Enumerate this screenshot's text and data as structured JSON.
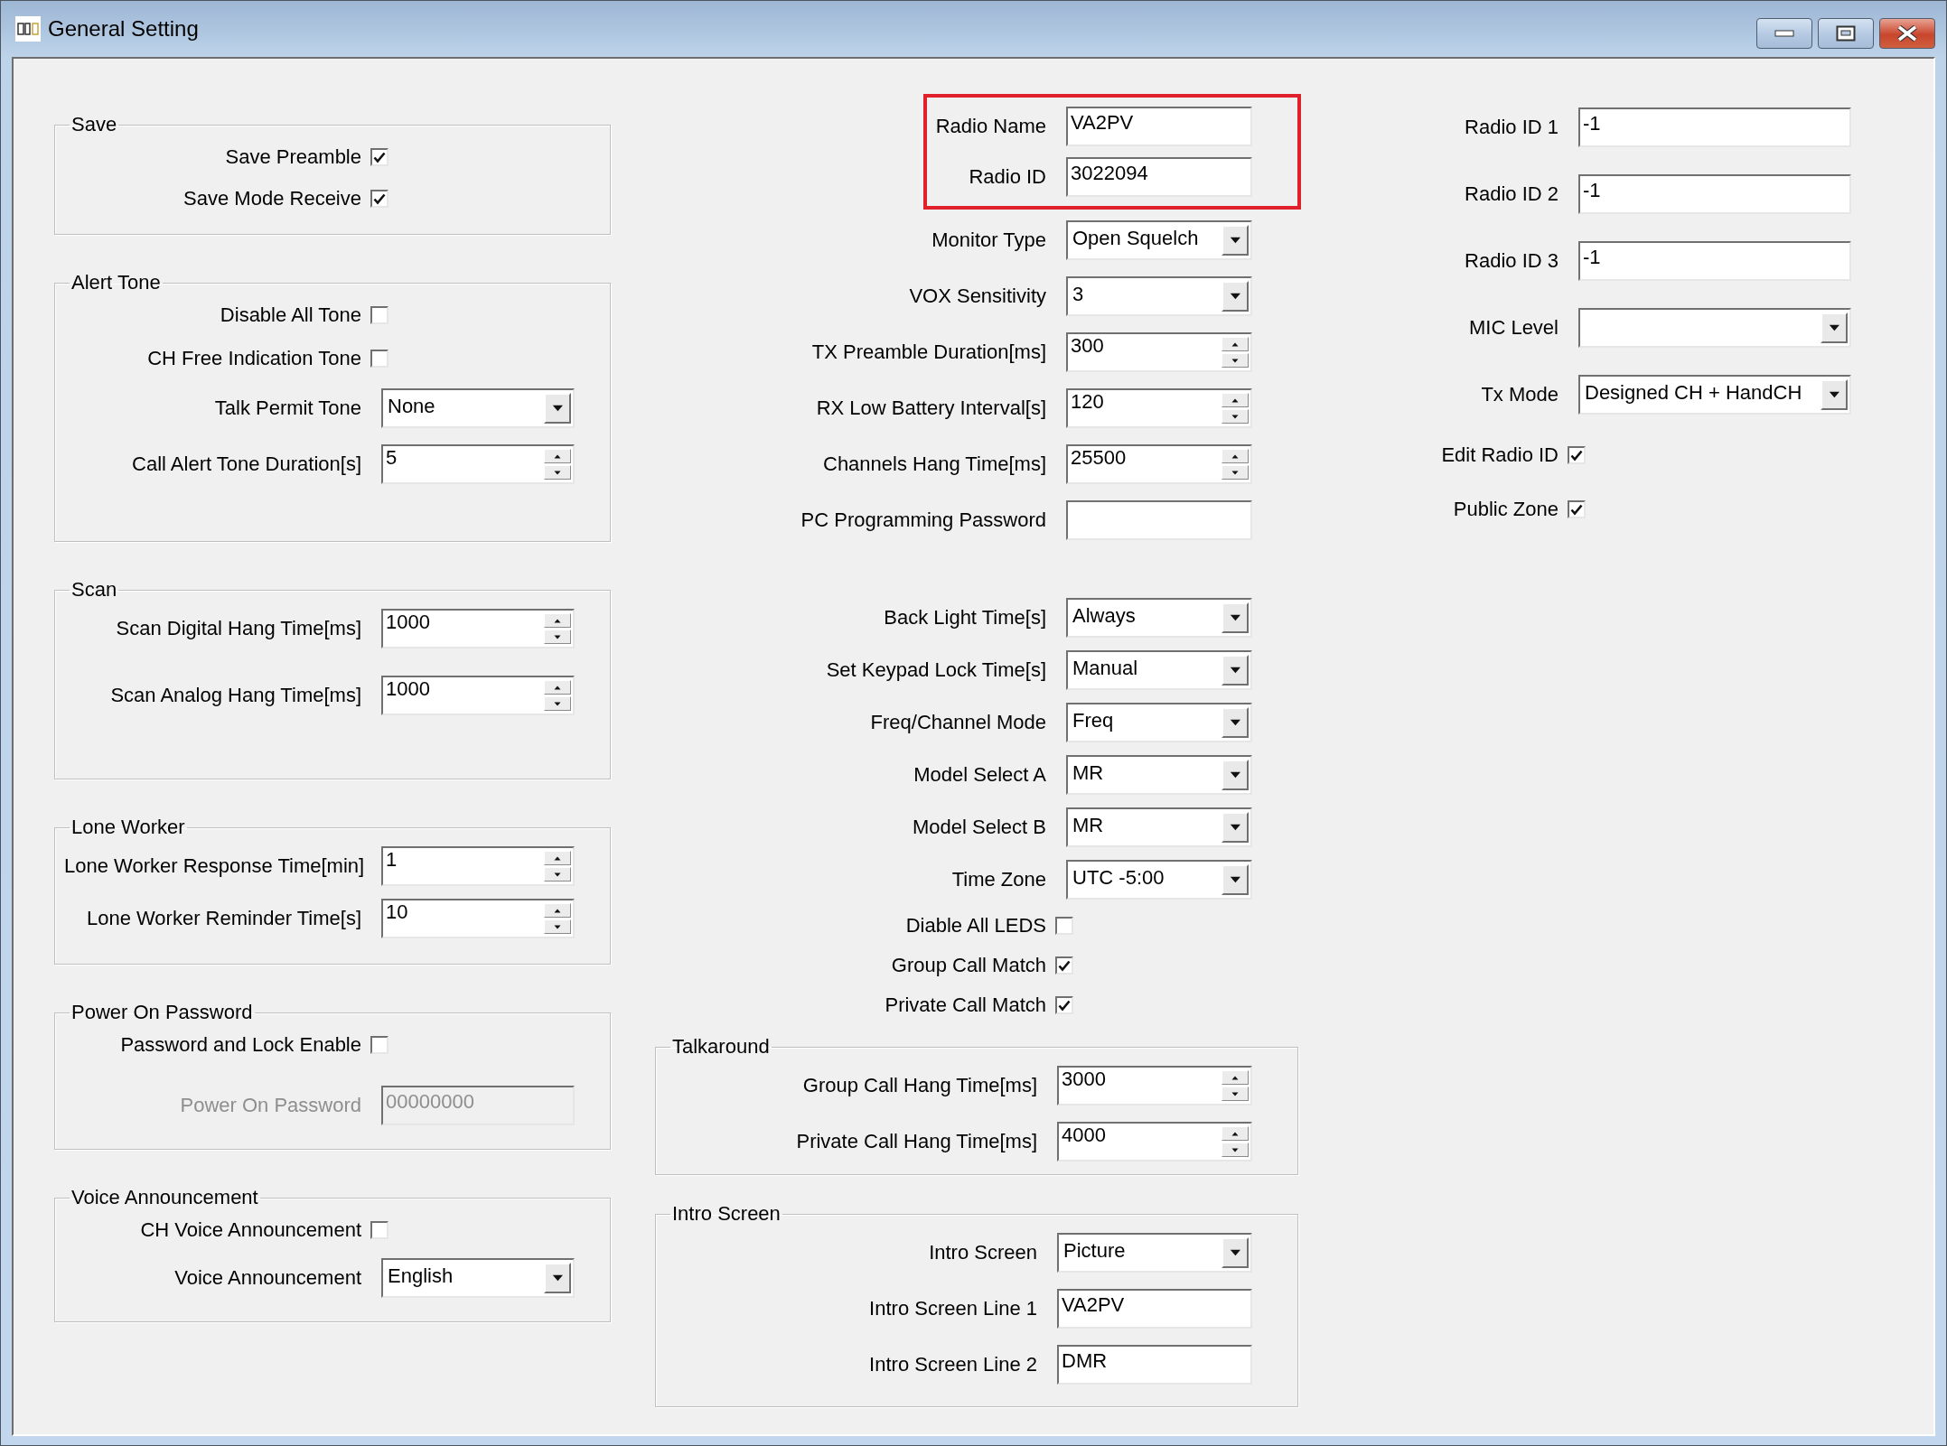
{
  "window": {
    "title": "General Setting"
  },
  "left_groups": [
    {
      "title": "Save",
      "rows": [
        {
          "kind": "check",
          "label": "Save Preamble",
          "checked": true
        },
        {
          "kind": "check",
          "label": "Save Mode Receive",
          "checked": true
        }
      ]
    },
    {
      "title": "Alert Tone",
      "rows": [
        {
          "kind": "check",
          "label": "Disable All Tone",
          "checked": false
        },
        {
          "kind": "check",
          "label": "CH Free Indication Tone",
          "checked": false
        },
        {
          "kind": "combo",
          "label": "Talk Permit Tone",
          "value": "None"
        },
        {
          "kind": "spin",
          "label": "Call Alert Tone Duration[s]",
          "value": "5"
        }
      ]
    },
    {
      "title": "Scan",
      "rows": [
        {
          "kind": "spin",
          "label": "Scan Digital Hang Time[ms]",
          "value": "1000"
        },
        {
          "kind": "spin",
          "label": "Scan Analog Hang Time[ms]",
          "value": "1000"
        }
      ]
    },
    {
      "title": "Lone Worker",
      "rows": [
        {
          "kind": "spin",
          "label": "Lone Worker Response Time[min]",
          "value": "1"
        },
        {
          "kind": "spin",
          "label": "Lone Worker Reminder Time[s]",
          "value": "10"
        }
      ]
    },
    {
      "title": "Power On Password",
      "rows": [
        {
          "kind": "check",
          "label": "Password and Lock Enable",
          "checked": false,
          "disabled": false
        },
        {
          "kind": "text",
          "label": "Power On Password",
          "value": "00000000",
          "disabled": true
        }
      ]
    },
    {
      "title": "Voice Announcement",
      "rows": [
        {
          "kind": "check",
          "label": "CH Voice Announcement",
          "checked": false
        },
        {
          "kind": "combo",
          "label": "Voice Announcement",
          "value": "English"
        }
      ]
    }
  ],
  "middle_sections": [
    {
      "highlighted": true,
      "rows": [
        {
          "kind": "text",
          "label": "Radio Name",
          "value": "VA2PV"
        },
        {
          "kind": "text",
          "label": "Radio ID",
          "value": "3022094"
        }
      ]
    },
    {
      "highlighted": false,
      "rows": [
        {
          "kind": "combo",
          "label": "Monitor Type",
          "value": "Open Squelch"
        },
        {
          "kind": "combo",
          "label": "VOX Sensitivity",
          "value": "3"
        },
        {
          "kind": "spin",
          "label": "TX Preamble Duration[ms]",
          "value": "300"
        },
        {
          "kind": "spin",
          "label": "RX Low Battery Interval[s]",
          "value": "120"
        },
        {
          "kind": "spin",
          "label": "Channels Hang Time[ms]",
          "value": "25500"
        },
        {
          "kind": "text",
          "label": "PC Programming Password"
        }
      ]
    },
    {
      "highlighted": false,
      "rows": [
        {
          "kind": "combo",
          "label": "Back Light Time[s]",
          "value": "Always"
        },
        {
          "kind": "combo",
          "label": "Set Keypad Lock Time[s]",
          "value": "Manual"
        },
        {
          "kind": "combo",
          "label": "Freq/Channel Mode",
          "value": "Freq"
        },
        {
          "kind": "combo",
          "label": "Model Select A",
          "value": "MR"
        },
        {
          "kind": "combo",
          "label": "Model Select B",
          "value": "MR"
        },
        {
          "kind": "combo",
          "label": "Time Zone",
          "value": "UTC -5:00"
        },
        {
          "kind": "check",
          "label": "Diable All LEDS",
          "checked": false
        },
        {
          "kind": "check",
          "label": "Group Call Match",
          "checked": true
        },
        {
          "kind": "check",
          "label": "Private Call Match",
          "checked": true
        }
      ]
    }
  ],
  "middle_groups": [
    {
      "title": "Talkaround",
      "rows": [
        {
          "kind": "spin",
          "label": "Group Call Hang Time[ms]",
          "value": "3000"
        },
        {
          "kind": "spin",
          "label": "Private Call Hang Time[ms]",
          "value": "4000"
        }
      ]
    },
    {
      "title": "Intro Screen",
      "rows": [
        {
          "kind": "combo",
          "label": "Intro Screen",
          "value": "Picture"
        },
        {
          "kind": "text",
          "label": "Intro Screen Line 1",
          "value": "VA2PV"
        },
        {
          "kind": "text",
          "label": "Intro Screen Line 2",
          "value": "DMR"
        }
      ]
    }
  ],
  "right_rows": [
    {
      "kind": "text",
      "label": "Radio ID 1",
      "value": "-1"
    },
    {
      "kind": "text",
      "label": "Radio ID 2",
      "value": "-1"
    },
    {
      "kind": "text",
      "label": "Radio ID 3",
      "value": "-1"
    },
    {
      "kind": "combo",
      "label": "MIC Level"
    },
    {
      "kind": "combo",
      "label": "Tx Mode",
      "value": "Designed CH + HandCH"
    },
    {
      "kind": "check",
      "label": "Edit Radio ID",
      "checked": true
    },
    {
      "kind": "check",
      "label": "Public Zone",
      "checked": true
    }
  ]
}
